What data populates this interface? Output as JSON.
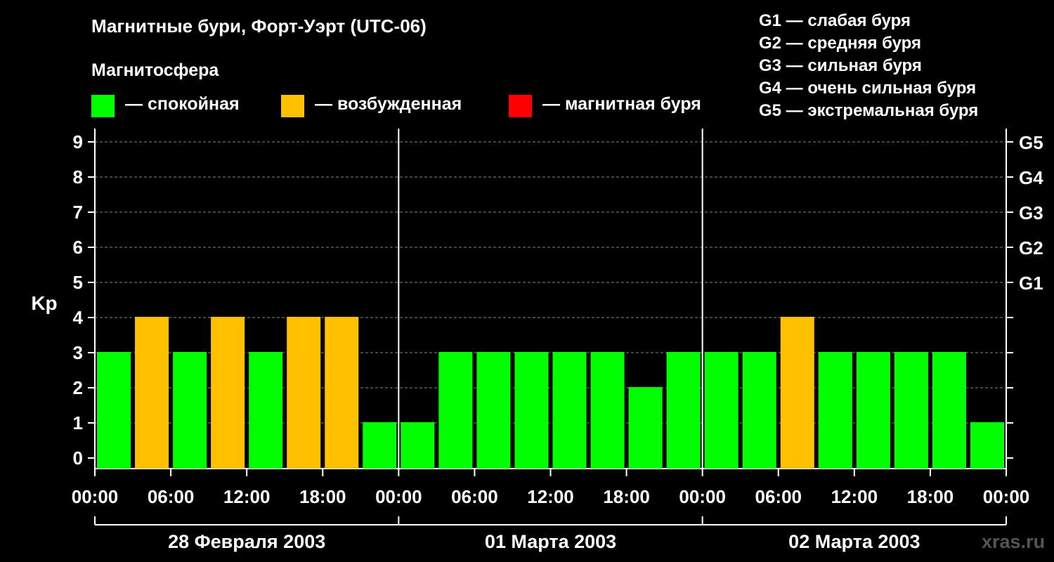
{
  "title": "Магнитные бури, Форт-Уэрт (UTC-06)",
  "subtitle": "Магнитосфера",
  "legend": [
    {
      "label": "— спокойная",
      "color": "#00ff00"
    },
    {
      "label": "— возбужденная",
      "color": "#ffc000"
    },
    {
      "label": "— магнитная буря",
      "color": "#ff0000"
    }
  ],
  "g_scale": [
    "G1 — слабая буря",
    "G2 — средняя буря",
    "G3 — сильная буря",
    "G4 — очень сильная буря",
    "G5 — экстремальная буря"
  ],
  "watermark": "xras.ru",
  "chart_data": {
    "type": "bar",
    "ylabel": "Kp",
    "ylim": [
      0,
      9
    ],
    "yticks": [
      "0",
      "1",
      "2",
      "3",
      "4",
      "5",
      "6",
      "7",
      "8",
      "9"
    ],
    "right_ticks": [
      {
        "value": 5,
        "label": "G1"
      },
      {
        "value": 6,
        "label": "G2"
      },
      {
        "value": 7,
        "label": "G3"
      },
      {
        "value": 8,
        "label": "G4"
      },
      {
        "value": 9,
        "label": "G5"
      }
    ],
    "x_tick_labels": [
      "00:00",
      "06:00",
      "12:00",
      "18:00",
      "00:00",
      "06:00",
      "12:00",
      "18:00",
      "00:00",
      "06:00",
      "12:00",
      "18:00",
      "00:00"
    ],
    "days": [
      "28 Февраля 2003",
      "01 Марта 2003",
      "02 Марта 2003"
    ],
    "values": [
      3,
      4,
      3,
      4,
      3,
      4,
      4,
      1,
      1,
      3,
      3,
      3,
      3,
      3,
      2,
      3,
      3,
      3,
      4,
      3,
      3,
      3,
      3,
      1
    ],
    "colors": {
      "quiet": "#00ff00",
      "active": "#ffc000",
      "storm": "#ff0000"
    },
    "grid": true
  }
}
